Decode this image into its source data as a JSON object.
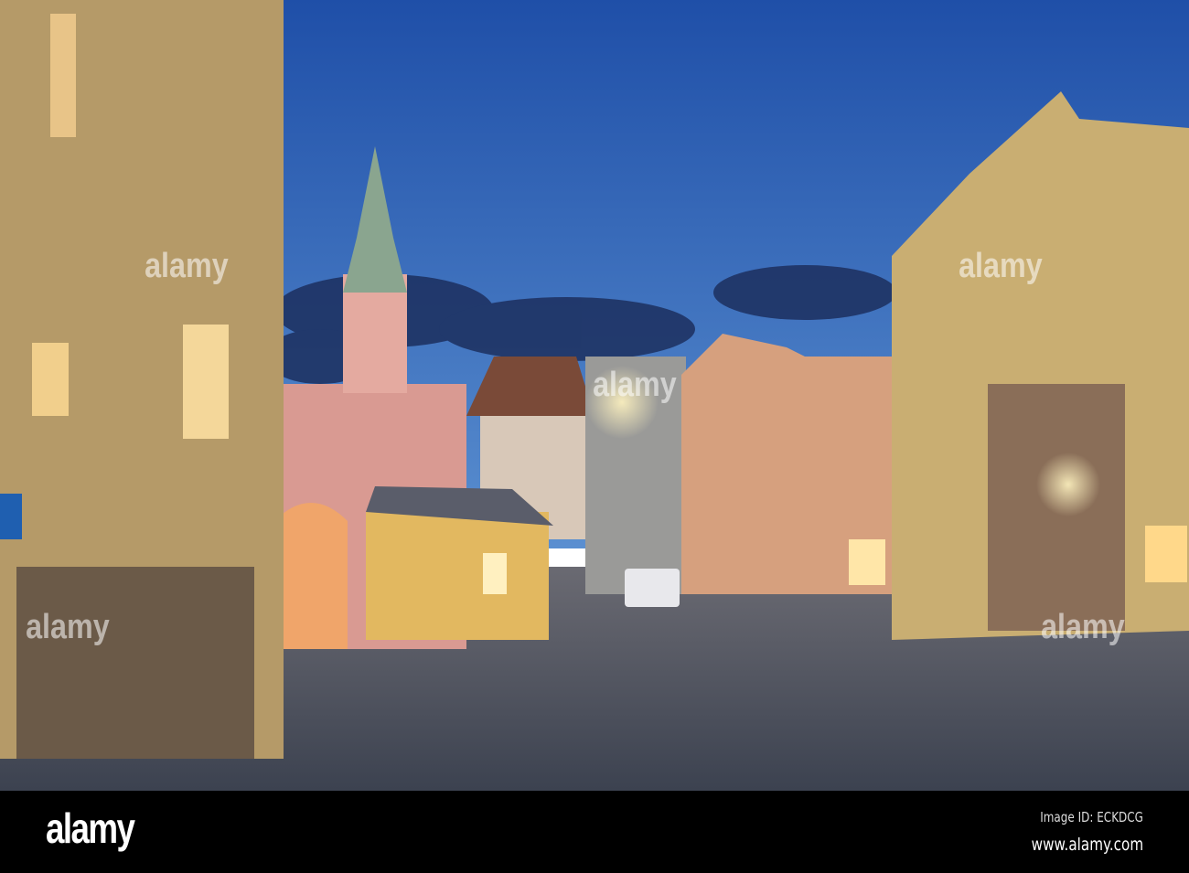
{
  "photo": {
    "subject": "Old town square at dusk with church tower and illuminated houses",
    "colors": {
      "sky_top": "#2457b0",
      "sky_bottom": "#4f86cc",
      "cobblestone": "#4b4f5c",
      "left_building": "#b59a68",
      "right_building": "#c9ae72",
      "church": "#d99a92"
    }
  },
  "watermark": {
    "text": "alamy"
  },
  "footer": {
    "logo": "alamy",
    "image_id": "Image ID: ECKDCG",
    "url": "www.alamy.com"
  }
}
